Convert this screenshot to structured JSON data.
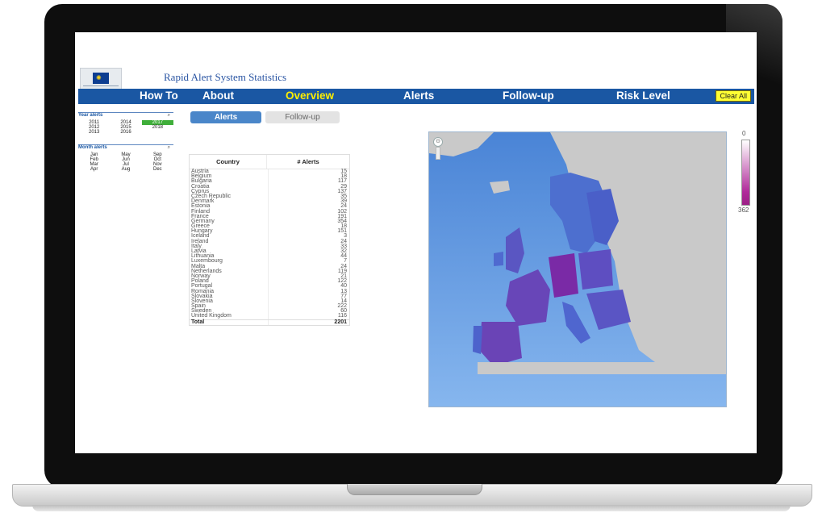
{
  "header": {
    "title": "Rapid Alert System Statistics"
  },
  "nav": {
    "items": [
      {
        "label": "How To",
        "active": false
      },
      {
        "label": "About",
        "active": false
      },
      {
        "label": "Overview",
        "active": true
      },
      {
        "label": "Alerts",
        "active": false
      },
      {
        "label": "Follow-up",
        "active": false
      },
      {
        "label": "Risk Level",
        "active": false
      }
    ],
    "clear_all": "Clear All"
  },
  "filters": {
    "year": {
      "label": "Year alerts",
      "search_icon": "search-icon",
      "items": [
        "2011",
        "2014",
        "2017",
        "2012",
        "2015",
        "2018",
        "2013",
        "2016",
        ""
      ],
      "selected": [
        "2017"
      ]
    },
    "month": {
      "label": "Month alerts",
      "search_icon": "search-icon",
      "items": [
        "Jan",
        "May",
        "Sep",
        "Feb",
        "Jun",
        "Oct",
        "Mar",
        "Jul",
        "Nov",
        "Apr",
        "Aug",
        "Dec"
      ]
    }
  },
  "tabs": {
    "alerts": "Alerts",
    "follow_up": "Follow-up"
  },
  "table": {
    "headers": {
      "country": "Country",
      "alerts": "# Alerts"
    },
    "rows": [
      [
        "Austria",
        "15"
      ],
      [
        "Belgium",
        "18"
      ],
      [
        "Bulgaria",
        "117"
      ],
      [
        "Croatia",
        "29"
      ],
      [
        "Cyprus",
        "137"
      ],
      [
        "Czech Republic",
        "35"
      ],
      [
        "Denmark",
        "39"
      ],
      [
        "Estonia",
        "24"
      ],
      [
        "Finland",
        "102"
      ],
      [
        "France",
        "191"
      ],
      [
        "Germany",
        "354"
      ],
      [
        "Greece",
        "18"
      ],
      [
        "Hungary",
        "151"
      ],
      [
        "Iceland",
        "3"
      ],
      [
        "Ireland",
        "24"
      ],
      [
        "Italy",
        "33"
      ],
      [
        "Latvia",
        "32"
      ],
      [
        "Lithuania",
        "44"
      ],
      [
        "Luxembourg",
        "7"
      ],
      [
        "Malta",
        "24"
      ],
      [
        "Netherlands",
        "119"
      ],
      [
        "Norway",
        "21"
      ],
      [
        "Poland",
        "122"
      ],
      [
        "Portugal",
        "40"
      ],
      [
        "Romania",
        "13"
      ],
      [
        "Slovakia",
        "77"
      ],
      [
        "Slovenia",
        "14"
      ],
      [
        "Spain",
        "222"
      ],
      [
        "Sweden",
        "60"
      ],
      [
        "United Kingdom",
        "116"
      ]
    ],
    "total": [
      "Total",
      "2201"
    ]
  },
  "legend": {
    "min": "0",
    "max": "362",
    "color_low": "#ffffff",
    "color_high": "#9b1f86"
  },
  "colors": {
    "nav_bg": "#1a57a3",
    "nav_active": "#ffee00",
    "selected_year": "#3fae3a",
    "sea": "#6fa6e6",
    "land": "#c9c9c9"
  }
}
